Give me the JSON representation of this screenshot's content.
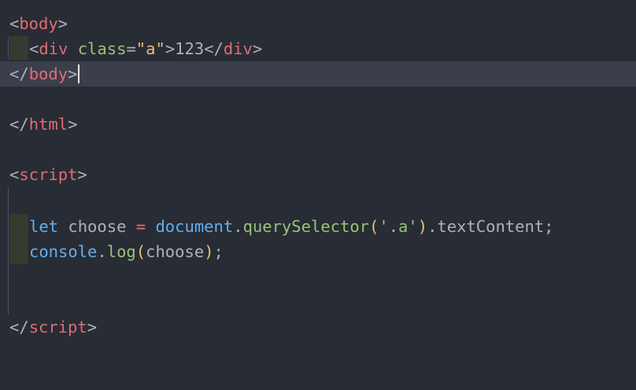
{
  "editor": {
    "lines": {
      "l1": {
        "open": "<",
        "tag": "body",
        "close": ">"
      },
      "l2": {
        "open": "<",
        "tag": "div",
        "attr": "class",
        "eq": "=",
        "value": "\"a\"",
        "gt": ">",
        "text": "123",
        "open2": "</",
        "tag2": "div",
        "close2": ">"
      },
      "l3": {
        "open": "</",
        "tag": "body",
        "close": ">"
      },
      "l5": {
        "open": "</",
        "tag": "html",
        "close": ">"
      },
      "l7": {
        "open": "<",
        "tag": "script",
        "close": ">"
      },
      "l9": {
        "kw": "let",
        "var": " choose ",
        "op": "=",
        "obj": "document",
        "dot": ".",
        "method": "querySelector",
        "lp": "(",
        "arg": "'.a'",
        "rp": ")",
        "prop": ".textContent;"
      },
      "l10": {
        "obj": "console",
        "dot": ".",
        "method": "log",
        "lp": "(",
        "arg": "choose",
        "rp": ")",
        "end": ";"
      },
      "l13": {
        "open": "</",
        "tag": "script",
        "close": ">"
      }
    }
  }
}
